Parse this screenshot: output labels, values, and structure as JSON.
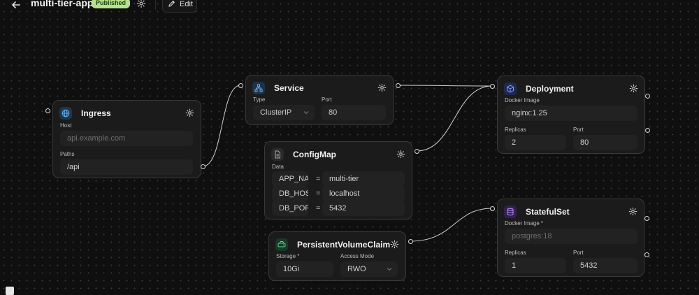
{
  "header": {
    "app_name": "multi-tier-app",
    "status_badge": "Published",
    "edit_label": "Edit"
  },
  "nodes": {
    "ingress": {
      "title": "Ingress",
      "icon": "globe-icon",
      "accent": "#3b82c4",
      "host_label": "Host",
      "host_placeholder": "api.example.com",
      "paths_label": "Paths",
      "paths_value": "/api"
    },
    "service": {
      "title": "Service",
      "icon": "network-icon",
      "accent": "#4a9ad8",
      "type_label": "Type",
      "type_value": "ClusterIP",
      "port_label": "Port",
      "port_value": "80"
    },
    "configmap": {
      "title": "ConfigMap",
      "icon": "file-icon",
      "accent": "#7a7a7a",
      "data_label": "Data",
      "entries": [
        {
          "key": "APP_NA",
          "sep": "=",
          "value": "multi-tier"
        },
        {
          "key": "DB_HOS",
          "sep": "=",
          "value": "localhost"
        },
        {
          "key": "DB_POR",
          "sep": "=",
          "value": "5432"
        }
      ]
    },
    "pvc": {
      "title": "PersistentVolumeClaim",
      "icon": "hard-drive-icon",
      "accent": "#3fa86a",
      "storage_label": "Storage *",
      "storage_value": "10Gi",
      "access_label": "Access Mode",
      "access_value": "RWO"
    },
    "deployment": {
      "title": "Deployment",
      "icon": "box-icon",
      "accent": "#4f6fd8",
      "image_label": "Docker Image",
      "image_value": "nginx:1.25",
      "replicas_label": "Replicas",
      "replicas_value": "2",
      "port_label": "Port",
      "port_value": "80"
    },
    "statefulset": {
      "title": "StatefulSet",
      "icon": "database-icon",
      "accent": "#8a5ad0",
      "image_label": "Docker Image *",
      "image_placeholder": "postgres:18",
      "replicas_label": "Replicas",
      "replicas_value": "1",
      "port_label": "Port",
      "port_value": "5432"
    }
  },
  "colors": {
    "badge_bg": "#b6e28f",
    "canvas_bg": "#0f0f0f",
    "node_bg": "#1b1b1b",
    "wire": "#cfcfcf"
  }
}
